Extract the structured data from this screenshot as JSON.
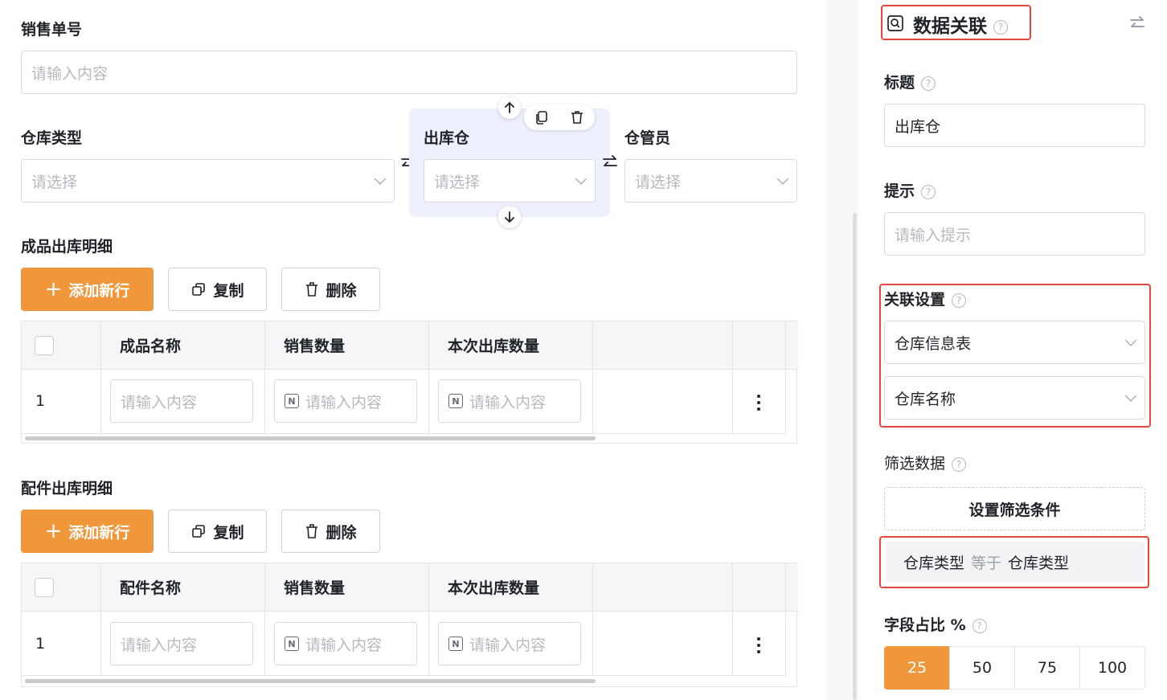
{
  "form": {
    "sales_no": {
      "label": "销售单号",
      "placeholder": "请输入内容"
    },
    "warehouse_type": {
      "label": "仓库类型",
      "placeholder": "请选择"
    },
    "outbound_warehouse": {
      "label": "出库仓",
      "placeholder": "请选择"
    },
    "keeper": {
      "label": "仓管员",
      "placeholder": "请选择"
    }
  },
  "product_section": {
    "title": "成品出库明细",
    "add_label": "添加新行",
    "copy_label": "复制",
    "delete_label": "删除",
    "columns": [
      "成品名称",
      "销售数量",
      "本次出库数量"
    ],
    "rows": [
      {
        "index": "1",
        "cells": [
          "请输入内容",
          "请输入内容",
          "请输入内容"
        ]
      }
    ]
  },
  "parts_section": {
    "title": "配件出库明细",
    "add_label": "添加新行",
    "copy_label": "复制",
    "delete_label": "删除",
    "columns": [
      "配件名称",
      "销售数量",
      "本次出库数量"
    ],
    "rows": [
      {
        "index": "1",
        "cells": [
          "请输入内容",
          "请输入内容",
          "请输入内容"
        ]
      }
    ]
  },
  "panel": {
    "header": "数据关联",
    "title_label": "标题",
    "title_value": "出库仓",
    "hint_label": "提示",
    "hint_placeholder": "请输入提示",
    "relation_label": "关联设置",
    "relation_table": "仓库信息表",
    "relation_field": "仓库名称",
    "filter_label": "筛选数据",
    "filter_button": "设置筛选条件",
    "filter_condition": {
      "left": "仓库类型",
      "op": "等于",
      "right": "仓库类型"
    },
    "width_label": "字段占比 %",
    "width_options": [
      "25",
      "50",
      "75",
      "100"
    ],
    "width_selected": "25"
  },
  "colors": {
    "accent": "#f0973c",
    "highlight": "#e5473c",
    "selected_bg": "#eef1fd"
  }
}
